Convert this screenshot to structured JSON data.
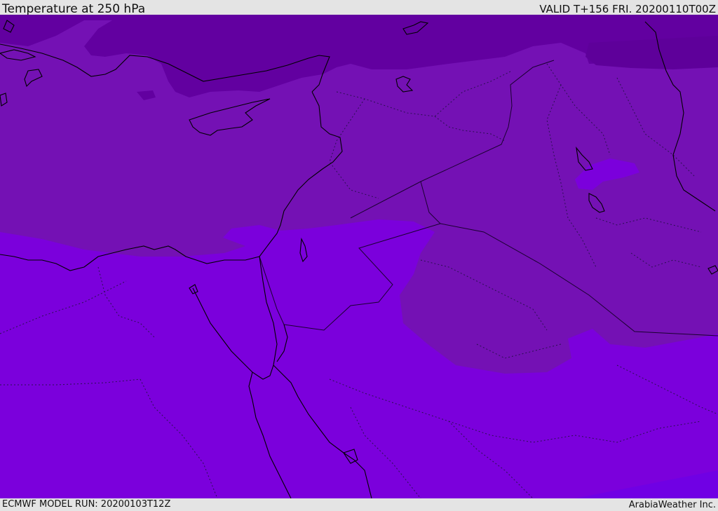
{
  "header": {
    "title": "Temperature at 250 hPa",
    "valid": "VALID T+156 FRI. 20200110T00Z"
  },
  "footer": {
    "model_run": "ECMWF MODEL RUN: 20200103T12Z",
    "credit": "ArabiaWeather Inc."
  },
  "map": {
    "colors": {
      "coldest_band": "#6200a0",
      "cold_band": "#7411b4",
      "mid_band": "#7b00dc",
      "warm_band": "#7000e4",
      "coastline": "#000000",
      "border": "#2a1050"
    }
  }
}
